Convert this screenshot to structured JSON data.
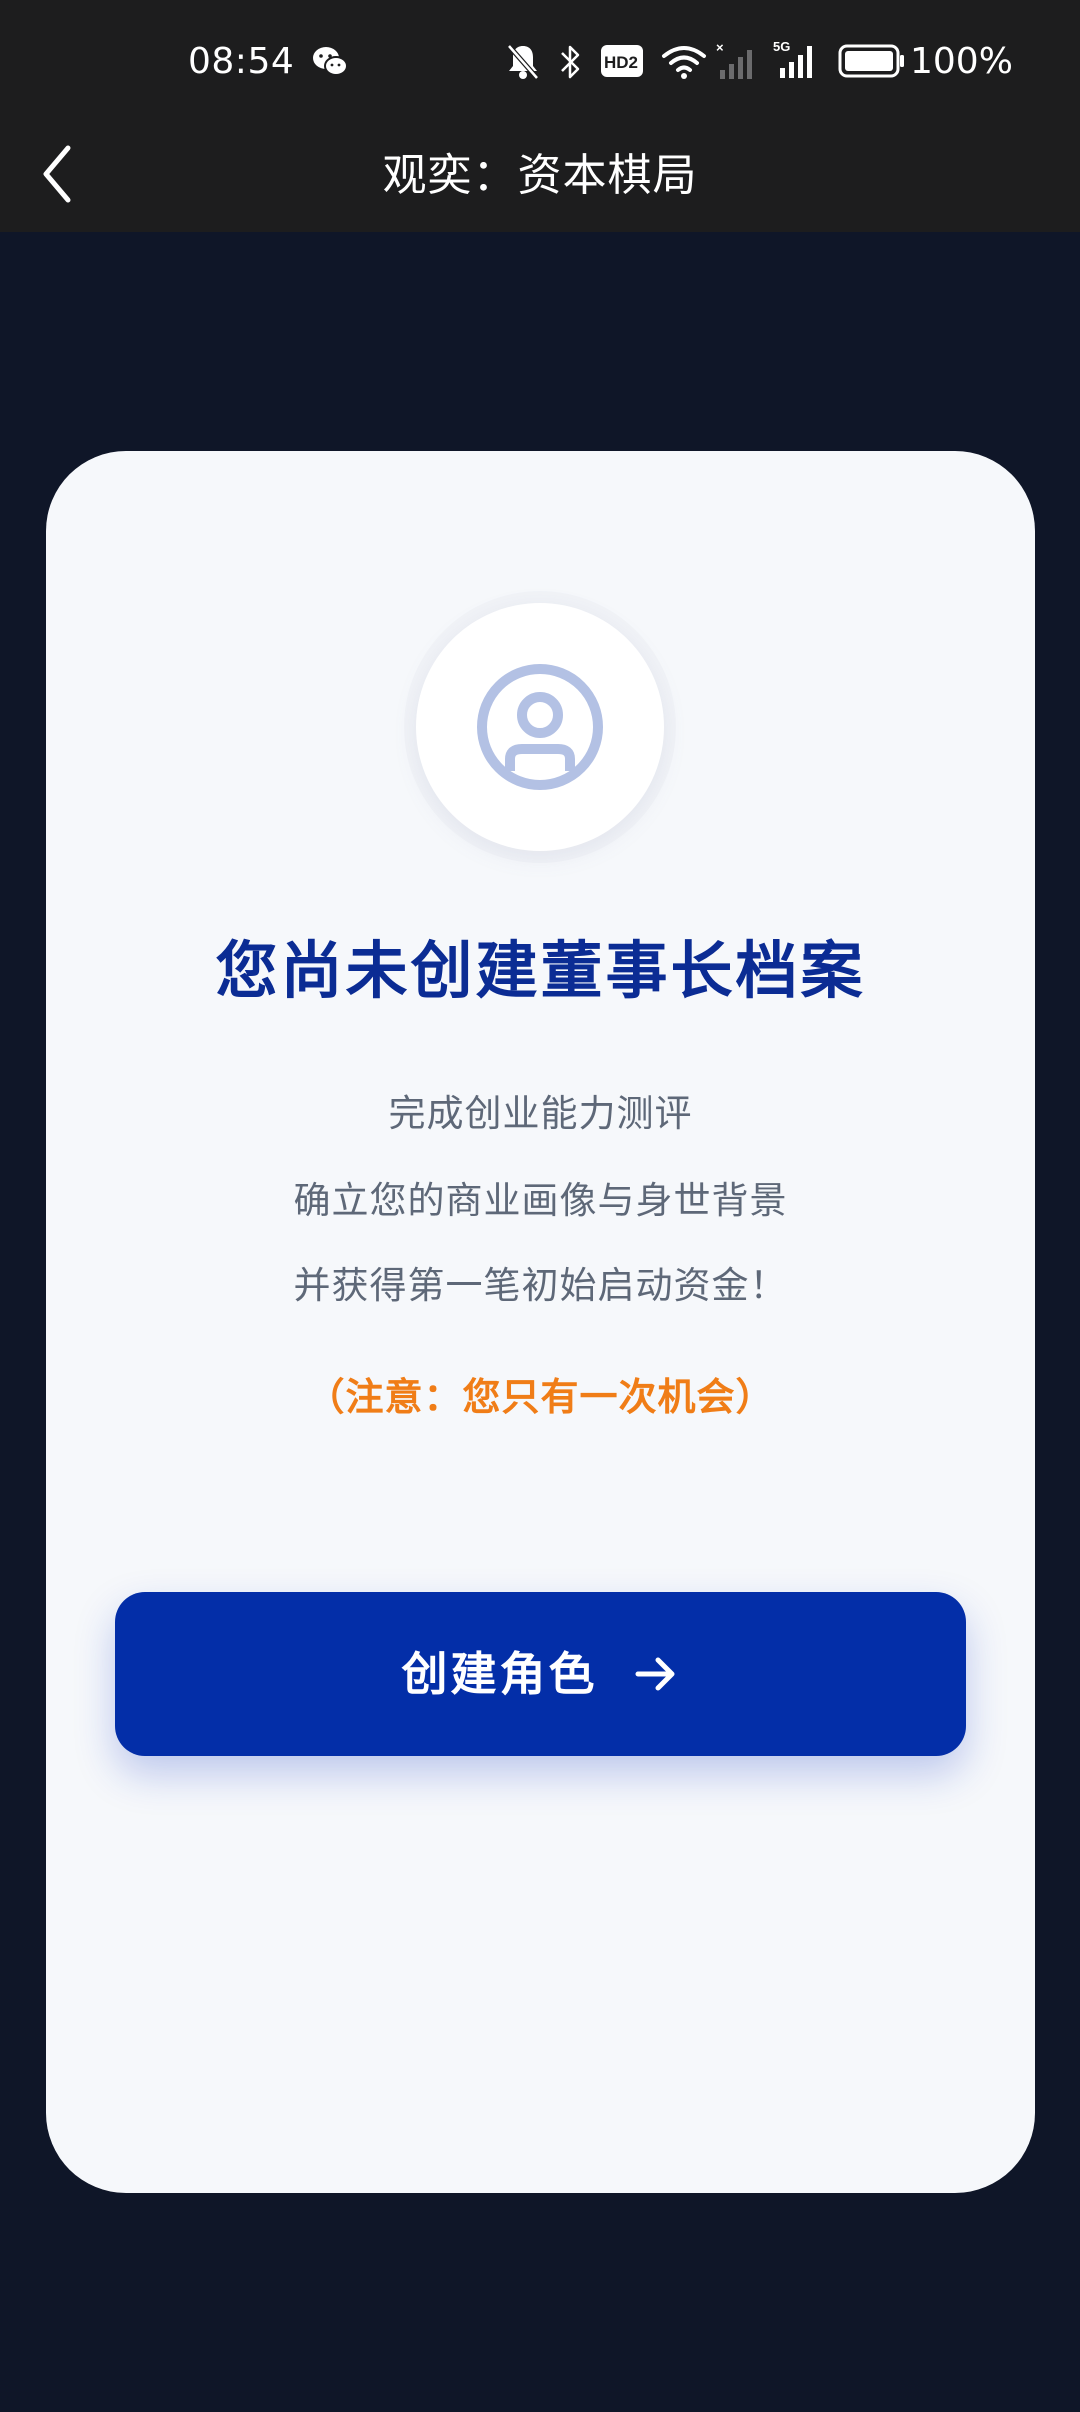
{
  "status_bar": {
    "time": "08:54",
    "battery": "100%",
    "icons": [
      "wechat-icon",
      "mute-icon",
      "bluetooth-icon",
      "hd-icon",
      "wifi-icon",
      "sim-signal-icon",
      "5g-signal-icon",
      "battery-icon"
    ],
    "hd_label": "HD2",
    "network_label": "5G"
  },
  "nav": {
    "title": "观奕：资本棋局",
    "back_icon": "chevron-left-icon"
  },
  "card": {
    "avatar_icon": "user-profile-icon",
    "headline": "您尚未创建董事长档案",
    "description": [
      "完成创业能力测评",
      "确立您的商业画像与身世背景",
      "并获得第一笔初始启动资金！"
    ],
    "warning": "（注意：您只有一次机会）",
    "button_label": "创建角色",
    "button_icon": "arrow-right-icon"
  },
  "colors": {
    "page_bg": "#0f1628",
    "bar_bg": "#1d1d1e",
    "card_bg": "#f6f8fb",
    "headline": "#0b2c94",
    "body_text": "#5e6878",
    "warning": "#f07d17",
    "button_bg": "#032ea8",
    "icon_tint": "#b3c1e4"
  }
}
